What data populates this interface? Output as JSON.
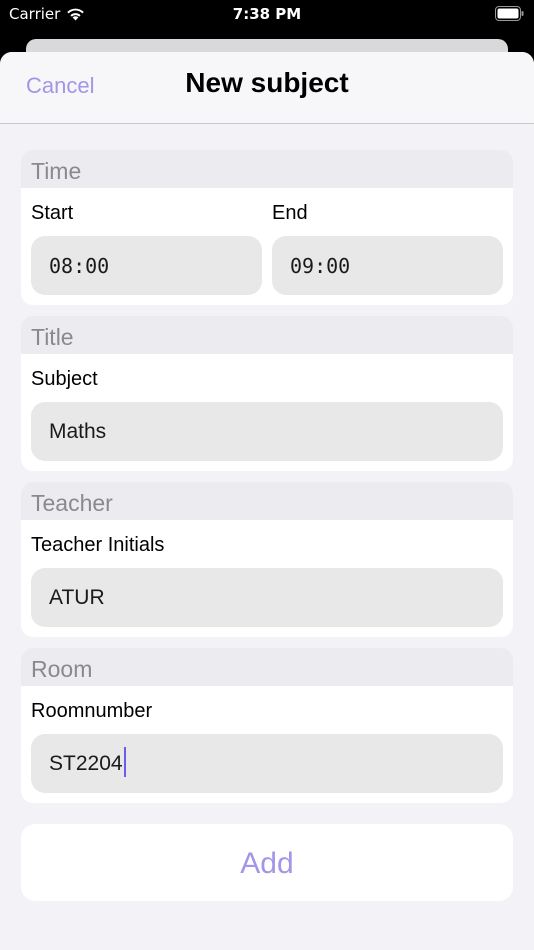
{
  "status_bar": {
    "carrier": "Carrier",
    "time": "7:38 PM"
  },
  "nav": {
    "cancel_label": "Cancel",
    "title": "New subject"
  },
  "sections": {
    "time": {
      "header": "Time",
      "start_label": "Start",
      "start_value": "08:00",
      "end_label": "End",
      "end_value": "09:00"
    },
    "title": {
      "header": "Title",
      "subject_label": "Subject",
      "subject_value": "Maths"
    },
    "teacher": {
      "header": "Teacher",
      "initials_label": "Teacher Initials",
      "initials_value": "ATUR"
    },
    "room": {
      "header": "Room",
      "roomnumber_label": "Roomnumber",
      "roomnumber_value": "ST2204"
    }
  },
  "add_button": {
    "label": "Add"
  },
  "colors": {
    "accent": "#a296e6",
    "caret": "#6b5ce7",
    "sheet_background": "#f2f2f7",
    "input_background": "#e8e8e9"
  }
}
